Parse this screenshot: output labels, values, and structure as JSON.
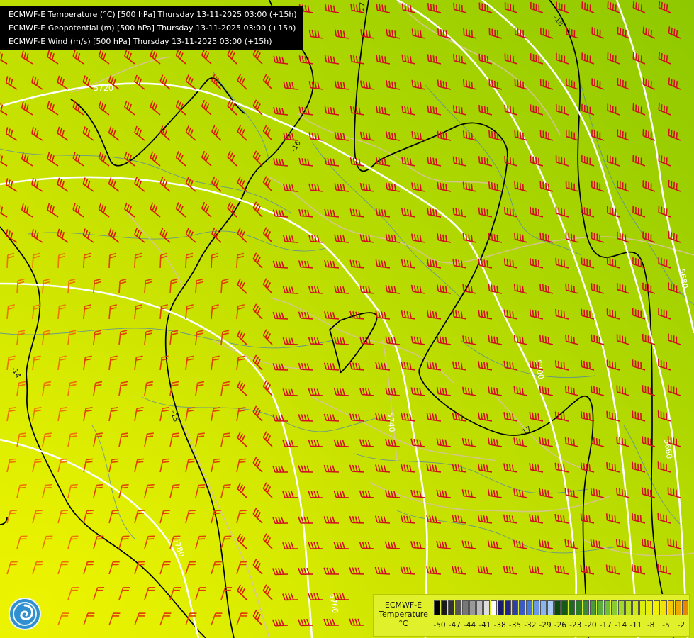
{
  "header": {
    "lines": [
      "ECMWF-E Temperature (°C) [500 hPa] Thursday 13-11-2025 03:00 (+15h)",
      "ECMWF-E Geopotential (m) [500 hPa] Thursday 13-11-2025 03:00 (+15h)",
      "ECMWF-E Wind (m/s) [500 hPa] Thursday 13-11-2025 03:00 (+15h)"
    ]
  },
  "geopotential_labels": [
    "5720",
    "5700",
    "5760",
    "5780",
    "5680",
    "5660",
    "5740"
  ],
  "temperature_labels": [
    "-17",
    "-18",
    "-16",
    "-15",
    "-14"
  ],
  "colorbar": {
    "title_line1": "ECMWF-E",
    "title_line2": "Temperature",
    "unit": "°C",
    "ticks": [
      "-50",
      "-47",
      "-44",
      "-41",
      "-38",
      "-35",
      "-32",
      "-29",
      "-26",
      "-23",
      "-20",
      "-17",
      "-14",
      "-11",
      "-8",
      "-5",
      "-2"
    ],
    "colors": [
      "#000000",
      "#1a1a1a",
      "#333333",
      "#555555",
      "#777777",
      "#999999",
      "#bbbbbb",
      "#dddddd",
      "#ffffff",
      "#1a1a6a",
      "#23238a",
      "#2e3ea8",
      "#3a5ac4",
      "#4a78d8",
      "#6a98e6",
      "#8ab4f0",
      "#a8ccf6",
      "#0c4a0c",
      "#165a16",
      "#206a20",
      "#2a7a2a",
      "#388a38",
      "#489c3a",
      "#5aae3c",
      "#70be3a",
      "#88cc34",
      "#a0d82c",
      "#b8e222",
      "#cce816",
      "#dcee0c",
      "#e8f000",
      "#f4f000",
      "#f8e000",
      "#f8c800",
      "#f0a800",
      "#e88800",
      "#d86400",
      "#c84000",
      "#b81c00",
      "#a80030",
      "#900060",
      "#800090",
      "#7000b0",
      "#6000c0",
      "#4a00a0",
      "#380080"
    ]
  },
  "logo": {
    "icon": "logo-icon"
  }
}
